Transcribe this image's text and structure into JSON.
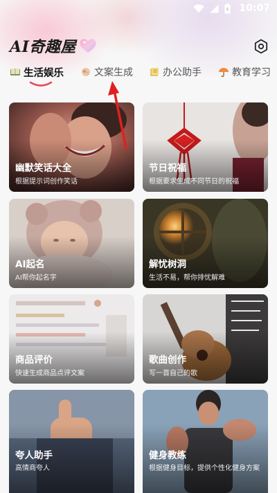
{
  "status_bar": {
    "time": "10:07"
  },
  "header": {
    "app_title": "AI奇趣屋"
  },
  "tabs": [
    {
      "label": "生活娱乐",
      "active": true
    },
    {
      "label": "文案生成",
      "active": false
    },
    {
      "label": "办公助手",
      "active": false
    },
    {
      "label": "教育学习",
      "active": false
    }
  ],
  "cards": [
    {
      "title": "幽默笑话大全",
      "subtitle": "根据提示词创作笑话"
    },
    {
      "title": "节日祝福",
      "subtitle": "根据要求生成不同节日的祝福"
    },
    {
      "title": "AI起名",
      "subtitle": "AI帮你起名字"
    },
    {
      "title": "解忧树洞",
      "subtitle": "生活不易，帮你排忧解难"
    },
    {
      "title": "商品评价",
      "subtitle": "快速生成商品点评文案"
    },
    {
      "title": "歌曲创作",
      "subtitle": "写一首自己的歌"
    },
    {
      "title": "夸人助手",
      "subtitle": "高情商夸人"
    },
    {
      "title": "健身教练",
      "subtitle": "根据健身目标，提供个性化健身方案"
    }
  ],
  "colors": {
    "accent": "#e8485f",
    "arrow": "#e02020"
  }
}
